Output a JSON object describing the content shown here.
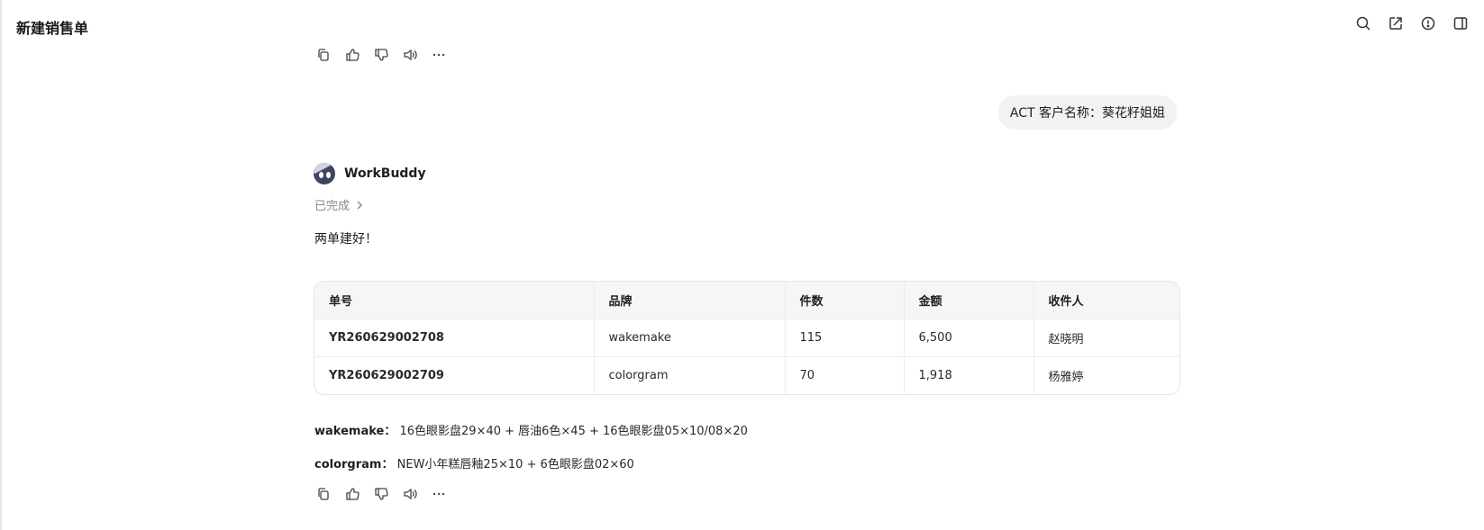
{
  "header": {
    "title": "新建销售单",
    "icons": [
      "search-icon",
      "share-icon",
      "history-icon",
      "sidebar-toggle-icon"
    ]
  },
  "user_message": {
    "text": "ACT 客户名称：葵花籽姐姐"
  },
  "assistant": {
    "name": "WorkBuddy",
    "status": "已完成",
    "message": "两单建好！",
    "table": {
      "headers": [
        "单号",
        "品牌",
        "件数",
        "金额",
        "收件人"
      ],
      "rows": [
        [
          "YR260629002708",
          "wakemake",
          "115",
          "6,500",
          "赵晓明"
        ],
        [
          "YR260629002709",
          "colorgram",
          "70",
          "1,918",
          "杨雅婷"
        ]
      ]
    },
    "notes": [
      {
        "label": "wakemake：",
        "text": "16色眼影盘29×40 + 唇油6色×45 + 16色眼影盘05×10/08×20"
      },
      {
        "label": "colorgram：",
        "text": "NEW小年糕唇釉25×10 + 6色眼影盘02×60"
      }
    ]
  },
  "message_actions": [
    "copy-icon",
    "thumbs-up-icon",
    "thumbs-down-icon",
    "speaker-icon",
    "more-icon"
  ],
  "colors": {
    "bubble_bg": "#f2f2f2",
    "table_header_bg": "#f6f6f6",
    "muted_text": "#8a8a8a",
    "avatar_bg": "#3f4560"
  }
}
